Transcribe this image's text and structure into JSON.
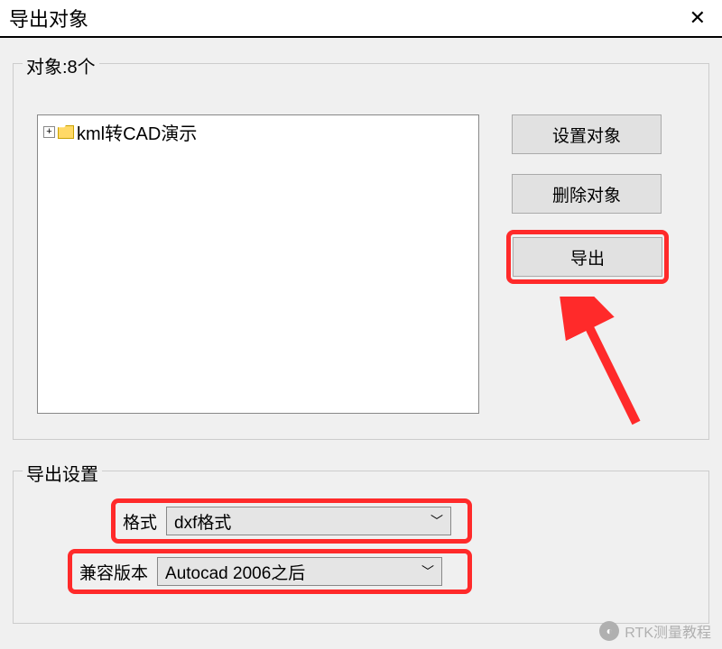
{
  "window": {
    "title": "导出对象"
  },
  "objects": {
    "legend": "对象:8个",
    "tree_item": "kml转CAD演示",
    "buttons": {
      "set_object": "设置对象",
      "delete_object": "删除对象",
      "export": "导出"
    }
  },
  "settings": {
    "legend": "导出设置",
    "format_label": "格式",
    "format_value": "dxf格式",
    "compat_label": "兼容版本",
    "compat_value": "Autocad 2006之后"
  },
  "watermark": "RTK测量教程",
  "highlight_color": "#ff2a2a"
}
